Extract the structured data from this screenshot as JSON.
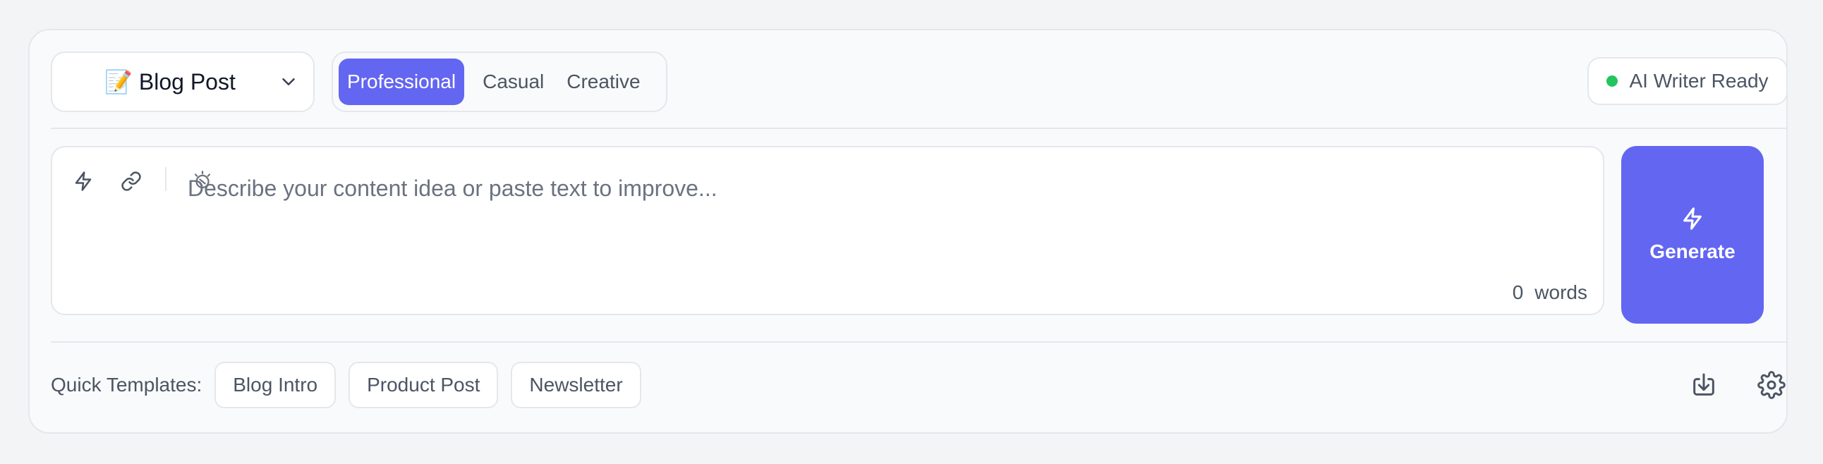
{
  "content_type": {
    "emoji": "📝",
    "label": "Blog Post",
    "icon": "chevron-down-icon"
  },
  "tones": [
    {
      "label": "Professional",
      "active": true
    },
    {
      "label": "Casual",
      "active": false
    },
    {
      "label": "Creative",
      "active": false
    }
  ],
  "status": {
    "label": "AI Writer Ready",
    "color": "#22c55e"
  },
  "editor": {
    "placeholder": "Describe your content idea or paste text to improve...",
    "value": "",
    "word_count": "0",
    "word_unit": "words",
    "tools": [
      "lightning-icon",
      "link-icon"
    ]
  },
  "generate": {
    "label": "Generate",
    "icon": "lightning-icon",
    "color": "#6366f1"
  },
  "quick_templates": {
    "label": "Quick Templates:",
    "items": [
      "Blog Intro",
      "Product Post",
      "Newsletter"
    ]
  },
  "actions": {
    "icons": [
      "download-icon",
      "gear-icon"
    ]
  }
}
